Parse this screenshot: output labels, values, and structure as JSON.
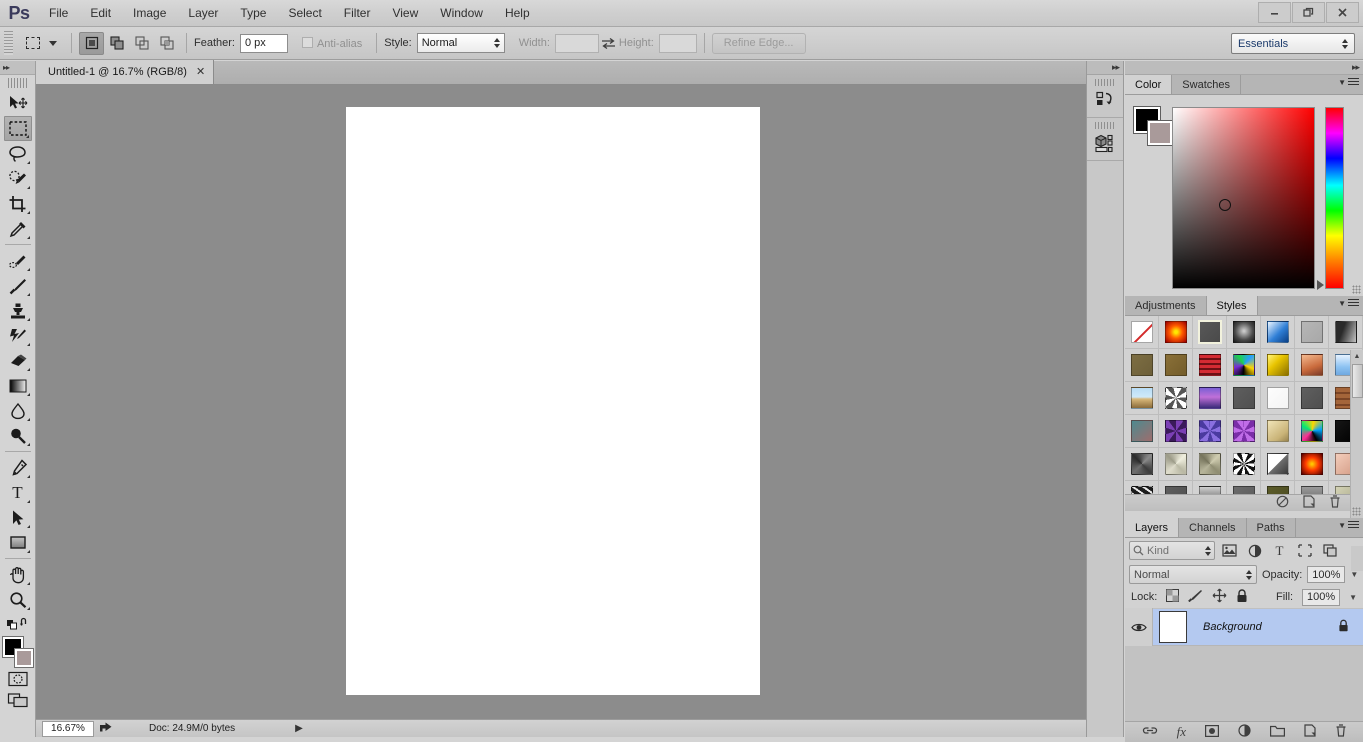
{
  "app": {
    "logo": "Ps",
    "menus": [
      "File",
      "Edit",
      "Image",
      "Layer",
      "Type",
      "Select",
      "Filter",
      "View",
      "Window",
      "Help"
    ],
    "window_controls": {
      "minimize": "—",
      "restore": "❐",
      "close": "✕"
    }
  },
  "options_bar": {
    "tool": "rectangular-marquee",
    "selection_modes": [
      "new-selection",
      "add-to-selection",
      "subtract-from-selection",
      "intersect-with-selection"
    ],
    "active_selection_mode": "new-selection",
    "feather_label": "Feather:",
    "feather_value": "0 px",
    "antialias_label": "Anti-alias",
    "antialias_checked": false,
    "style_label": "Style:",
    "style_value": "Normal",
    "width_label": "Width:",
    "width_value": "",
    "height_label": "Height:",
    "height_value": "",
    "swap_icon": "swap-dimensions-icon",
    "refine_edge_label": "Refine Edge...",
    "workspace": "Essentials"
  },
  "toolbox": {
    "tools_top": [
      {
        "name": "move-tool",
        "has_submenu": false
      },
      {
        "name": "rectangular-marquee-tool",
        "has_submenu": true,
        "active": true
      },
      {
        "name": "lasso-tool",
        "has_submenu": true
      },
      {
        "name": "quick-selection-tool",
        "has_submenu": true
      },
      {
        "name": "crop-tool",
        "has_submenu": true
      },
      {
        "name": "eyedropper-tool",
        "has_submenu": true
      }
    ],
    "tools_mid": [
      {
        "name": "spot-healing-brush-tool",
        "has_submenu": true
      },
      {
        "name": "brush-tool",
        "has_submenu": true
      },
      {
        "name": "clone-stamp-tool",
        "has_submenu": true
      },
      {
        "name": "history-brush-tool",
        "has_submenu": true
      },
      {
        "name": "eraser-tool",
        "has_submenu": true
      },
      {
        "name": "gradient-tool",
        "has_submenu": true
      },
      {
        "name": "blur-tool",
        "has_submenu": true
      },
      {
        "name": "dodge-tool",
        "has_submenu": true
      }
    ],
    "tools_bot": [
      {
        "name": "pen-tool",
        "has_submenu": true
      },
      {
        "name": "horizontal-type-tool",
        "has_submenu": true
      },
      {
        "name": "path-selection-tool",
        "has_submenu": true
      },
      {
        "name": "rectangle-tool",
        "has_submenu": true
      }
    ],
    "tools_nav": [
      {
        "name": "hand-tool",
        "has_submenu": true
      },
      {
        "name": "zoom-tool",
        "has_submenu": true
      }
    ],
    "foreground_color": "#000000",
    "background_color": "#a99a9a",
    "quick_mask_label": "edit-in-quick-mask-mode",
    "screen_mode_label": "change-screen-mode"
  },
  "document": {
    "tab_title": "Untitled-1 @ 16.7% (RGB/8)",
    "tab_close": "✕",
    "canvas_bg": "#8c8c8c",
    "canvas_fill": "#ffffff"
  },
  "status_bar": {
    "zoom": "16.67%",
    "share_icon": "share-icon",
    "doc_info": "Doc: 24.9M/0 bytes",
    "expand_arrow": "▶"
  },
  "mini_dock": {
    "collapse_icon": "▸▸",
    "items": [
      {
        "name": "history-panel-icon"
      },
      {
        "name": "mini-bridge-panel-icon"
      }
    ]
  },
  "color_panel": {
    "expand_icon": "▸▸",
    "tabs": [
      {
        "label": "Color",
        "active": true
      },
      {
        "label": "Swatches",
        "active": false
      }
    ],
    "foreground": "#000000",
    "background": "#a99a9a",
    "menu_icon": "panel-menu-icon"
  },
  "styles_panel": {
    "tabs": [
      {
        "label": "Adjustments",
        "active": false
      },
      {
        "label": "Styles",
        "active": true
      }
    ],
    "menu_icon": "panel-menu-icon",
    "footer_buttons": [
      {
        "name": "clear-style-button",
        "icon": "no-style-icon"
      },
      {
        "name": "new-style-button",
        "icon": "new-page-icon"
      },
      {
        "name": "delete-style-button",
        "icon": "trash-icon"
      }
    ],
    "swatches": [
      {
        "name": "default-none",
        "css": "linear-gradient(135deg,#ffffff,#ffffff)",
        "slash": true
      },
      {
        "name": "sunset-sky",
        "css": "radial-gradient(circle at 50% 50%,#ffe800 10%,#ff5a00 45%,#a00000 100%)"
      },
      {
        "name": "basic-drop-shadow",
        "css": "linear-gradient(135deg,#585858,#4a4a4a)",
        "selected": true
      },
      {
        "name": "dark-metal",
        "css": "radial-gradient(circle at 50% 45%,#c9c9c9 5%,#4a4a4a 60%,#1a1a1a 100%)"
      },
      {
        "name": "blue-glass",
        "css": "linear-gradient(135deg,#eaf4ff 0%,#2f7fd6 55%,#0b3f86 100%)"
      },
      {
        "name": "flat-gray",
        "css": "linear-gradient(135deg,#b6b6b6,#a8a8a8)"
      },
      {
        "name": "dark-fade",
        "css": "linear-gradient(110deg,#2a2a2a 35%,#c4c4c4 100%)"
      },
      {
        "name": "olive-brown",
        "css": "linear-gradient(135deg,#7d6e43,#6d5f39)"
      },
      {
        "name": "golden-brown",
        "css": "linear-gradient(135deg,#8a7038,#735c2a)"
      },
      {
        "name": "red-stripes",
        "css": "repeating-linear-gradient(to bottom,#d42b33 0 3px,#6d1014 3px 5px)"
      },
      {
        "name": "rainbow-abstract",
        "css": "conic-gradient(from 40deg,#27a0ff,#ffd500,#000,#7a2bd6,#1bd44a,#27a0ff)"
      },
      {
        "name": "yellow-bevel",
        "css": "linear-gradient(135deg,#fff27a 0%,#e8c400 40%,#8a6f00 100%)"
      },
      {
        "name": "sunset-blur",
        "css": "linear-gradient(160deg,#f4b98f,#c96a3c 60%,#7a3a28)"
      },
      {
        "name": "sky-blue-bevel",
        "css": "linear-gradient(180deg,#e6f2ff,#8cc2f2 60%,#6fa8e0)"
      },
      {
        "name": "beach-scene",
        "css": "linear-gradient(180deg,#b8dcf5 0%,#cfe9f9 45%,#d8b87a 55%,#8a6b3a 100%)"
      },
      {
        "name": "noise-texture",
        "css": "repeating-conic-gradient(#fff 0 8%,#555 0 16%)"
      },
      {
        "name": "purple-stripe",
        "css": "linear-gradient(180deg,#7a5fd4 0%,#c070d8 45%,#3a2a7a 100%)"
      },
      {
        "name": "plain-dark",
        "css": "linear-gradient(135deg,#5e5e5e,#505050)"
      },
      {
        "name": "white-outline",
        "css": "linear-gradient(135deg,#fdfdfd,#f4f4f4)"
      },
      {
        "name": "gray-button",
        "css": "linear-gradient(135deg,#5f5f5f,#4f4f4f)"
      },
      {
        "name": "brick-texture",
        "css": "repeating-linear-gradient(180deg,#a4653a 0 4px,#7b4526 4px 6px)"
      },
      {
        "name": "teal-rose",
        "css": "linear-gradient(140deg,#4e8a8f 0%,#9d6d6d 100%)"
      },
      {
        "name": "violet-noise",
        "css": "repeating-conic-gradient(#7b3fb5 0 10%,#3a1a5a 0 20%)"
      },
      {
        "name": "blue-violet-tex",
        "css": "repeating-conic-gradient(#8a6fe0 0 9%,#4a3aa0 0 18%)"
      },
      {
        "name": "magenta-noise",
        "css": "repeating-conic-gradient(#c06ce8 0 9%,#7a2ea8 0 18%)"
      },
      {
        "name": "sand-bevel",
        "css": "linear-gradient(140deg,#f0e4b8,#c9b377 70%,#9a8550)"
      },
      {
        "name": "prism-color",
        "css": "conic-gradient(from 10deg,#ffd700,#00a2ff,#000,#ff2d95,#00e676,#ffd700)"
      },
      {
        "name": "solid-black",
        "css": "linear-gradient(135deg,#161616,#000000)"
      },
      {
        "name": "gray-pyramid",
        "css": "conic-gradient(from 45deg,#8a8a8a,#3c3c3c,#6e6e6e,#2a2a2a,#8a8a8a)"
      },
      {
        "name": "cream-bevel",
        "css": "conic-gradient(from 45deg,#efeede,#b9b8a4,#dedccb,#9c9b88,#efeede)"
      },
      {
        "name": "khaki-bevel",
        "css": "conic-gradient(from 45deg,#cfccb0,#8f8d72,#b6b49a,#76745c,#cfccb0)"
      },
      {
        "name": "static-noise",
        "css": "repeating-conic-gradient(#fff 0 6%,#111 0 12%)"
      },
      {
        "name": "white-corner-fold",
        "css": "linear-gradient(135deg,#ffffff 48%,#6e6e6e 50%,#3a3a3a 100%)"
      },
      {
        "name": "red-glow",
        "css": "radial-gradient(circle at 50% 50%,#ffc400 6%,#ff3b00 45%,#5a0000 100%)"
      },
      {
        "name": "skin-tone",
        "css": "linear-gradient(140deg,#f3cdbb,#d49c86)"
      },
      {
        "name": "marble-dark",
        "css": "repeating-linear-gradient(35deg,#1c1c1c 0 4px,#eaeaea 4px 6px)"
      },
      {
        "name": "white-ring-gray",
        "css": "linear-gradient(135deg,#5e5e5e,#4e4e4e)"
      },
      {
        "name": "gray-gradient-sq",
        "css": "linear-gradient(180deg,#cfcfcf,#3d3d3d)"
      },
      {
        "name": "yellow-frame",
        "css": "linear-gradient(135deg,#6b6b6b,#5a5a5a)"
      },
      {
        "name": "gold-frame",
        "css": "linear-gradient(135deg,#5c5c2a,#4a4a20)"
      },
      {
        "name": "steel-gray",
        "css": "linear-gradient(180deg,#9a9a9a,#5a5a5a)"
      },
      {
        "name": "pale-olive",
        "css": "linear-gradient(135deg,#d3d2b4,#a8a78a)"
      }
    ]
  },
  "layers_panel": {
    "tabs": [
      {
        "label": "Layers",
        "active": true
      },
      {
        "label": "Channels",
        "active": false
      },
      {
        "label": "Paths",
        "active": false
      }
    ],
    "menu_icon": "panel-menu-icon",
    "filter_label": "Kind",
    "filter_icons": [
      {
        "name": "filter-pixel-layers-icon"
      },
      {
        "name": "filter-adjustment-layers-icon"
      },
      {
        "name": "filter-type-layers-icon"
      },
      {
        "name": "filter-shape-layers-icon"
      },
      {
        "name": "filter-smart-objects-icon"
      }
    ],
    "blend_mode": "Normal",
    "opacity_label": "Opacity:",
    "opacity_value": "100%",
    "lock_label": "Lock:",
    "lock_icons": [
      {
        "name": "lock-transparent-pixels-icon"
      },
      {
        "name": "lock-image-pixels-icon"
      },
      {
        "name": "lock-position-icon"
      },
      {
        "name": "lock-all-icon"
      }
    ],
    "fill_label": "Fill:",
    "fill_value": "100%",
    "layers": [
      {
        "name": "Background",
        "visible": true,
        "locked": true,
        "selected": true,
        "thumb": "#ffffff"
      }
    ],
    "footer_buttons": [
      {
        "name": "link-layers-button",
        "icon": "link-icon"
      },
      {
        "name": "layer-style-button",
        "icon": "fx-icon"
      },
      {
        "name": "add-layer-mask-button",
        "icon": "mask-icon"
      },
      {
        "name": "new-fill-adjustment-button",
        "icon": "half-circle-icon"
      },
      {
        "name": "new-group-button",
        "icon": "folder-icon"
      },
      {
        "name": "new-layer-button",
        "icon": "new-page-icon"
      },
      {
        "name": "delete-layer-button",
        "icon": "trash-icon"
      }
    ]
  }
}
